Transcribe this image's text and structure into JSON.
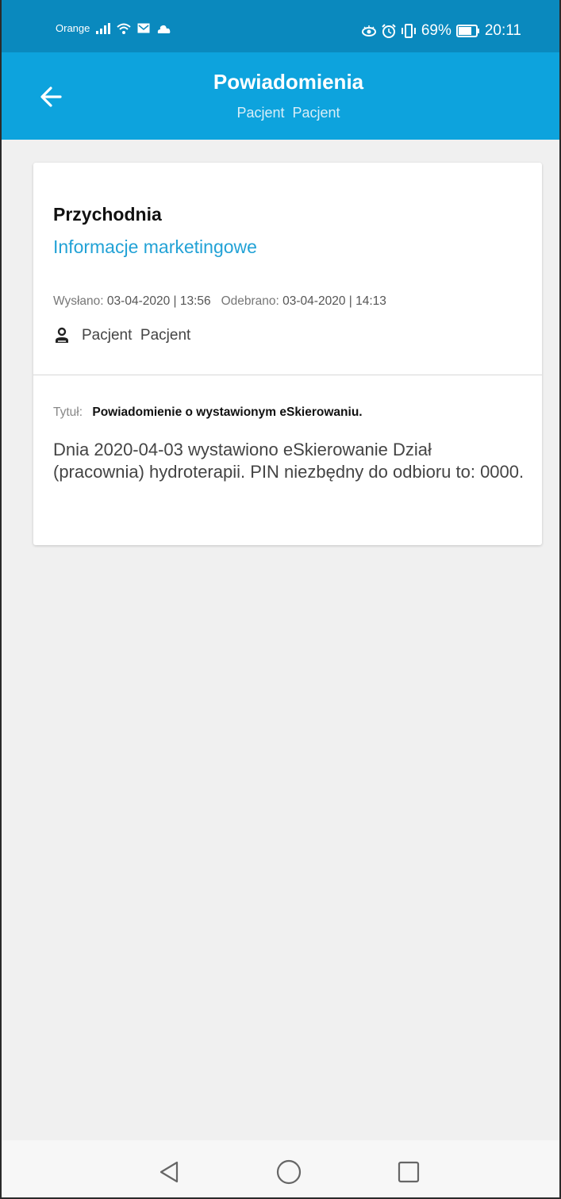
{
  "status_bar": {
    "carrier": "Orange",
    "battery": "69%",
    "time": "20:11"
  },
  "app_bar": {
    "title": "Powiadomienia",
    "subtitle": "Pacjent  Pacjent"
  },
  "notification": {
    "clinic": "Przychodnia",
    "category": "Informacje marketingowe",
    "sent_label": "Wysłano:",
    "sent_date": "03-04-2020",
    "sent_time": "13:56",
    "received_label": "Odebrano:",
    "received_date": "03-04-2020",
    "received_time": "14:13",
    "separator": "|",
    "recipient": "Pacjent  Pacjent",
    "title_label": "Tytuł:",
    "title": "Powiadomienie o wystawionym eSkierowaniu.",
    "message": "Dnia 2020-04-03 wystawiono eSkierowanie Dział (pracownia) hydroterapii. PIN niezbędny do odbioru to: 0000."
  },
  "icons": {
    "back": "arrow-left-icon",
    "person": "person-icon",
    "nav_back": "triangle-back-icon",
    "nav_home": "circle-home-icon",
    "nav_recent": "square-recent-icon"
  },
  "colors": {
    "status_bar": "#0a89be",
    "app_bar": "#0da3dd",
    "category": "#22a2d6",
    "background": "#f0f0f0"
  }
}
